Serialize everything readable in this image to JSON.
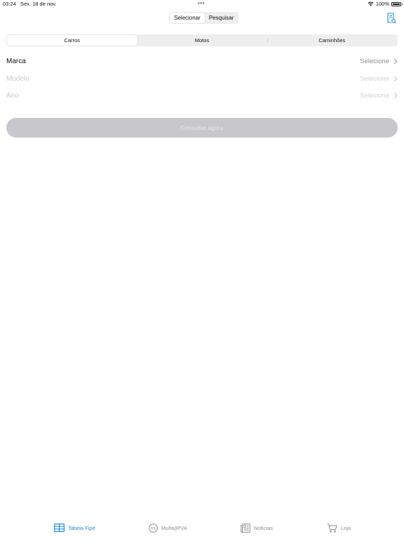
{
  "status_bar": {
    "time": "03:24",
    "date": "Sex. 18 de nov.",
    "battery": "100%"
  },
  "top_segment": {
    "options": [
      "Selecionar",
      "Pesquisar"
    ],
    "selected": "Selecionar"
  },
  "vehicle_segment": {
    "options": [
      "Carros",
      "Motos",
      "Caminhões"
    ],
    "selected": "Carros"
  },
  "form": {
    "rows": [
      {
        "label": "Marca",
        "value": "Selecione",
        "enabled": true
      },
      {
        "label": "Modelo",
        "value": "Selecione",
        "enabled": false
      },
      {
        "label": "Ano",
        "value": "Selecione",
        "enabled": false
      }
    ],
    "submit_label": "Consultar agora"
  },
  "tab_bar": {
    "items": [
      {
        "label": "Tabela Fipe",
        "icon": "table-icon",
        "active": true
      },
      {
        "label": "Multa|IPVA",
        "icon": "rs-coin-icon",
        "active": false
      },
      {
        "label": "Notícias",
        "icon": "newspaper-icon",
        "active": false
      },
      {
        "label": "Loja",
        "icon": "cart-icon",
        "active": false
      }
    ]
  },
  "colors": {
    "accent": "#1F8FD8",
    "disabled_button": "#C7C7CC",
    "inactive_tab": "#8E8E93"
  }
}
